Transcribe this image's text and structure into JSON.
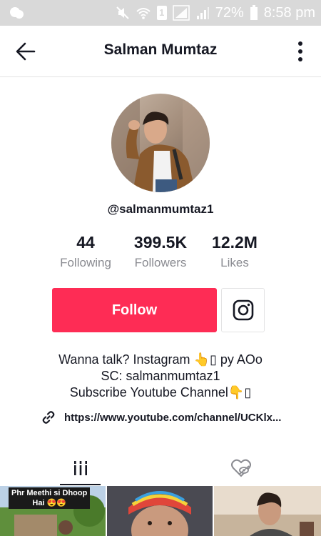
{
  "status_bar": {
    "battery_percent": "72%",
    "time": "8:58 pm",
    "sim_label": "1"
  },
  "header": {
    "title": "Salman Mumtaz",
    "back_icon": "arrow-left-icon",
    "more_icon": "more-vertical-icon"
  },
  "profile": {
    "handle": "@salmanmumtaz1",
    "stats": [
      {
        "value": "44",
        "label": "Following"
      },
      {
        "value": "399.5K",
        "label": "Followers"
      },
      {
        "value": "12.2M",
        "label": "Likes"
      }
    ],
    "follow_label": "Follow",
    "instagram_icon": "instagram-icon",
    "bio_lines": [
      "Wanna talk? Instagram 👆▯ py AOo",
      "SC: salmanmumtaz1",
      "Subscribe Youtube Channel👇▯"
    ],
    "link": "https://www.youtube.com/channel/UCKlx..."
  },
  "tabs": [
    {
      "name": "videos",
      "icon": "grid-bars-icon",
      "active": true
    },
    {
      "name": "liked",
      "icon": "heart-hidden-icon",
      "active": false
    }
  ],
  "videos": [
    {
      "caption_line1": "Phr Meethi si Dhoop",
      "caption_line2": "Hai 😍😍"
    },
    {
      "caption_line1": "",
      "caption_line2": ""
    },
    {
      "caption_line1": "",
      "caption_line2": ""
    }
  ],
  "colors": {
    "accent": "#fe2c55",
    "text": "#161823",
    "muted": "#8a8b91",
    "status_bar": "#d9d9d9"
  }
}
